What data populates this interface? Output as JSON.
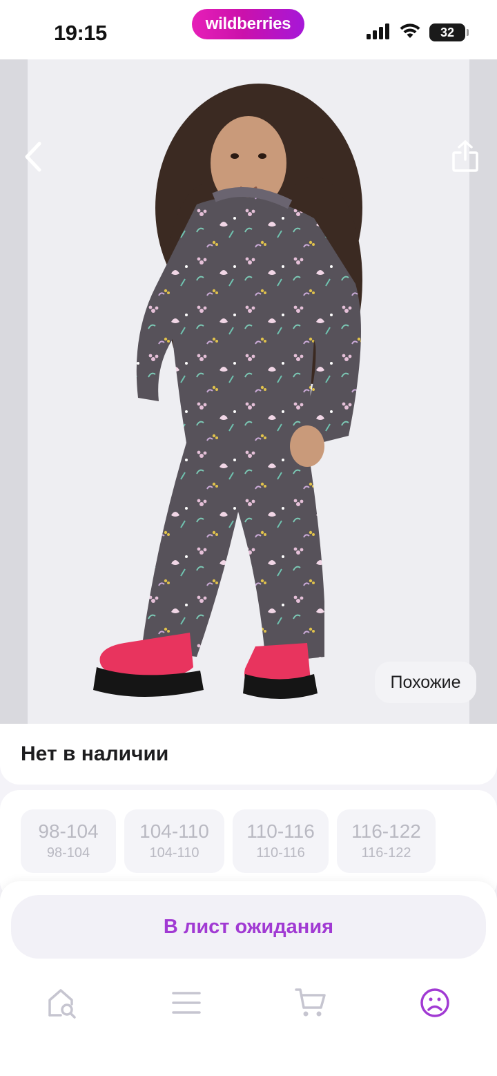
{
  "status_bar": {
    "time": "19:15",
    "brand": "wildberries",
    "battery": "32"
  },
  "product": {
    "availability": "Нет в наличии",
    "similar_label": "Похожие",
    "sizes": [
      {
        "label": "98-104",
        "sub": "98-104"
      },
      {
        "label": "104-110",
        "sub": "104-110"
      },
      {
        "label": "110-116",
        "sub": "110-116"
      },
      {
        "label": "116-122",
        "sub": "116-122"
      }
    ]
  },
  "actions": {
    "waitlist_label": "В лист ожидания"
  },
  "tabbar": {
    "items": [
      {
        "icon": "home-search-icon",
        "active": false
      },
      {
        "icon": "menu-icon",
        "active": false
      },
      {
        "icon": "cart-icon",
        "active": false
      },
      {
        "icon": "profile-icon",
        "active": true
      }
    ]
  },
  "colors": {
    "accent": "#a13ad3",
    "brand_gradient_start": "#e61fb8",
    "brand_gradient_end": "#a617d8",
    "inactive_icon": "#c6c5d0"
  }
}
